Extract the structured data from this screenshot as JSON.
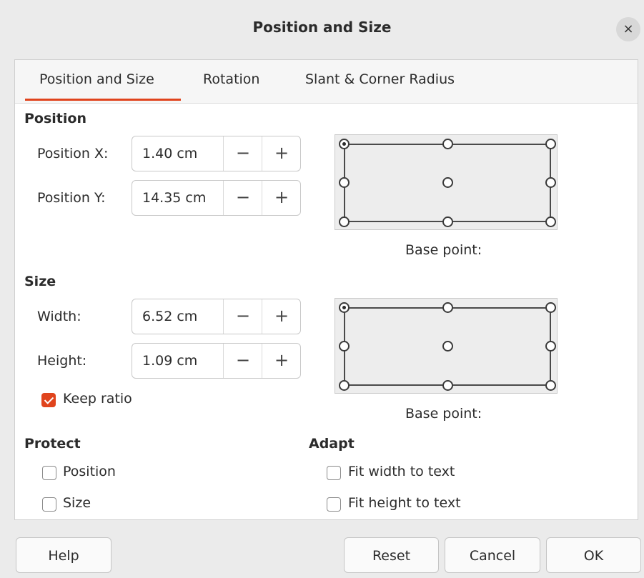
{
  "window": {
    "title": "Position and Size"
  },
  "tabs": [
    "Position and Size",
    "Rotation",
    "Slant & Corner Radius"
  ],
  "position": {
    "heading": "Position",
    "x": {
      "label": "Position X:",
      "value": "1.40 cm"
    },
    "y": {
      "label": "Position Y:",
      "value": "14.35 cm"
    },
    "base_point_label": "Base point:"
  },
  "size": {
    "heading": "Size",
    "width": {
      "label": "Width:",
      "value": "6.52 cm"
    },
    "height": {
      "label": "Height:",
      "value": "1.09 cm"
    },
    "keep_ratio": {
      "label": "Keep ratio",
      "checked": true
    },
    "base_point_label": "Base point:"
  },
  "spin": {
    "minus": "−",
    "plus": "+"
  },
  "protect": {
    "heading": "Protect",
    "position": {
      "label": "Position",
      "checked": false
    },
    "size": {
      "label": "Size",
      "checked": false
    }
  },
  "adapt": {
    "heading": "Adapt",
    "fit_width": {
      "label": "Fit width to text",
      "checked": false
    },
    "fit_height": {
      "label": "Fit height to text",
      "checked": false
    }
  },
  "buttons": {
    "help": "Help",
    "reset": "Reset",
    "cancel": "Cancel",
    "ok": "OK"
  },
  "close_glyph": "×",
  "colors": {
    "accent": "#e0441d"
  }
}
